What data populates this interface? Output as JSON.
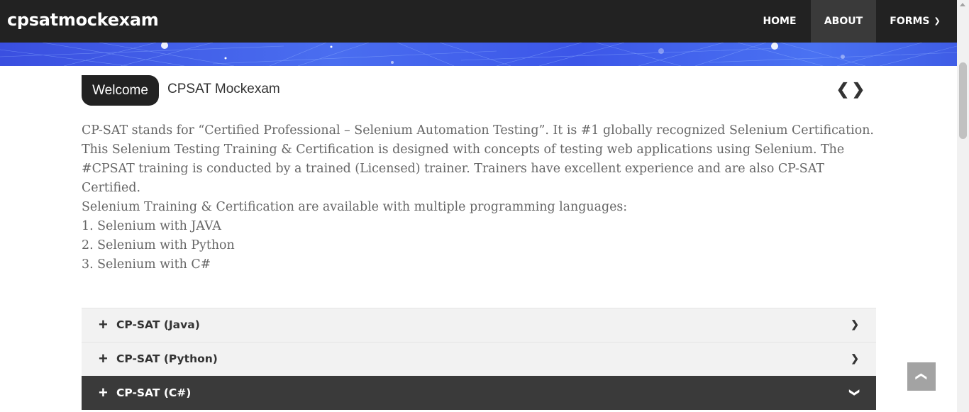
{
  "nav": {
    "brand": "cpsatmockexam",
    "items": [
      {
        "label": "HOME"
      },
      {
        "label": "ABOUT"
      },
      {
        "label": "FORMS"
      }
    ],
    "forms_chevron": "chevron-down-icon"
  },
  "welcome": {
    "tab_label": "Welcome",
    "title": "CPSAT Mockexam",
    "prev_icon": "chevron-left-icon",
    "next_icon": "chevron-right-icon"
  },
  "content": {
    "paragraph": "CP-SAT stands for “Certified Professional – Selenium Automation Testing”. It is #1 globally recognized Selenium Certification. This Selenium Testing Training & Certification is designed with concepts of testing web applications using Selenium. The #CPSAT training is conducted by a trained (Licensed) trainer. Trainers have excellent experience and are also CP-SAT Certified.",
    "languages_intro": "Selenium Training & Certification are available with multiple programming languages:",
    "languages": [
      "1. Selenium with JAVA",
      "2. Selenium with Python",
      "3. Selenium with C#"
    ]
  },
  "accordion": [
    {
      "label": "CP-SAT (Java)",
      "expanded": false
    },
    {
      "label": "CP-SAT (Python)",
      "expanded": false
    },
    {
      "label": "CP-SAT (C#)",
      "expanded": true
    }
  ],
  "colors": {
    "navbar": "#222222",
    "active_nav": "#3a3a3a",
    "hero": "#4a6ef0",
    "accordion_active": "#3a3a3a",
    "back_to_top": "#a3a3a3"
  }
}
